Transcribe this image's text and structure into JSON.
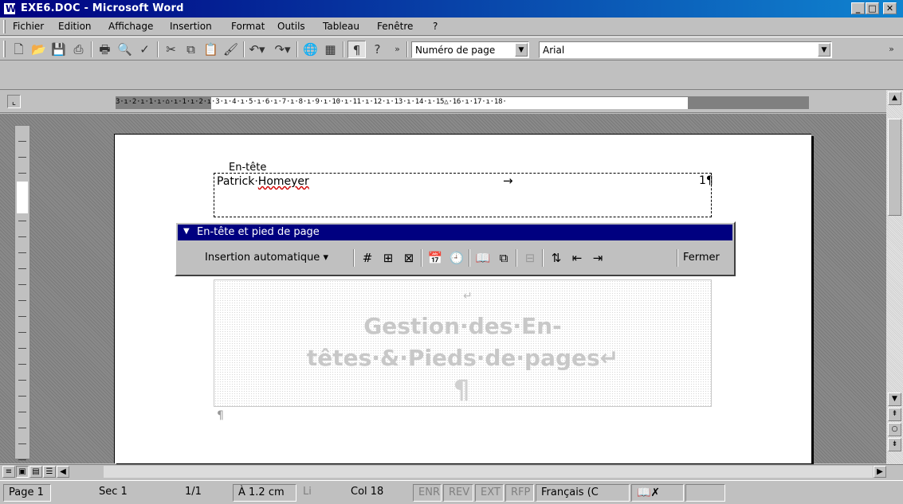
{
  "window": {
    "title": "EXE6.DOC - Microsoft Word"
  },
  "menubar": {
    "items": [
      "Fichier",
      "Edition",
      "Affichage",
      "Insertion",
      "Format",
      "Outils",
      "Tableau",
      "Fenêtre",
      "?"
    ]
  },
  "toolbar": {
    "style_value": "Numéro de page",
    "font_value": "Arial"
  },
  "ruler": {
    "ticks": "3·ı·2·ı·1·ı·⌂·ı·1·ı·2·ı·3·ı·4·ı·5·ı·6·ı·7·ı·8·ı·9·ı·10·ı·11·ı·12·ı·13·ı·14·ı·15△·16·ı·17·ı·18·"
  },
  "document": {
    "header_label": "En-tête",
    "header_name_first": "Patrick",
    "header_name_last": "Homeyer",
    "tab_arrow": "→",
    "page_number": "1¶",
    "body_return": "↵",
    "body_title": "Gestion·des·En-têtes·&·Pieds·de·pages↵",
    "body_pilcrow": "¶",
    "para_mark": "¶"
  },
  "hf_toolbar": {
    "title": "En-tête et pied de page",
    "auto_insert": "Insertion automatique ▾",
    "close": "Fermer"
  },
  "statusbar": {
    "page": "Page 1",
    "section": "Sec 1",
    "pages": "1/1",
    "position": "À 1.2 cm",
    "line": "Li",
    "col": "Col 18",
    "enr": "ENR",
    "rev": "REV",
    "ext": "EXT",
    "rfp": "RFP",
    "language": "Français (C"
  }
}
